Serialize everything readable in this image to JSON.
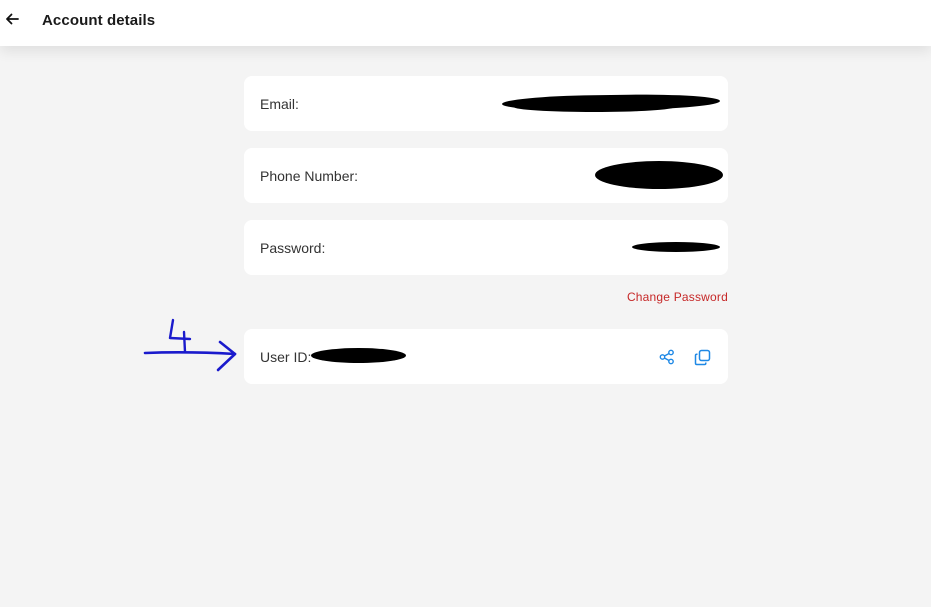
{
  "header": {
    "title": "Account details",
    "back_icon": "arrow-left-icon"
  },
  "fields": {
    "email_label": "Email:",
    "phone_label": "Phone Number:",
    "password_label": "Password:",
    "user_id_label": "User ID:"
  },
  "actions": {
    "change_password": "Change Password",
    "share_icon": "share-icon",
    "copy_icon": "copy-icon"
  },
  "annotation": {
    "marker_label": "4"
  },
  "colors": {
    "background": "#f4f4f4",
    "card": "#ffffff",
    "accent_blue": "#1e88e5",
    "danger_red": "#c62828",
    "annotation_blue": "#1a1acc"
  }
}
